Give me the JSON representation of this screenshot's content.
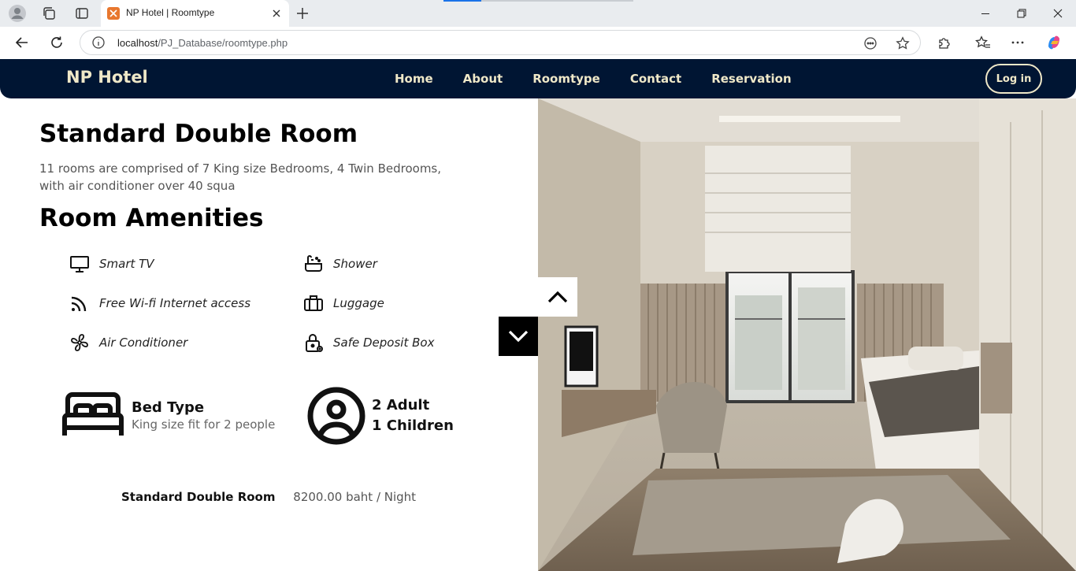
{
  "browser": {
    "tab_title": "NP Hotel | Roomtype",
    "url_host": "localhost",
    "url_path": "/PJ_Database/roomtype.php"
  },
  "site": {
    "brand": "NP Hotel",
    "nav": [
      "Home",
      "About",
      "Roomtype",
      "Contact",
      "Reservation"
    ],
    "login_label": "Log in"
  },
  "room": {
    "title": "Standard Double Room",
    "description": "11 rooms are comprised of 7 King size Bedrooms, 4 Twin Bedrooms, with air conditioner over 40 squa",
    "amenities_title": "Room Amenities",
    "amenities": [
      {
        "label": "Smart TV",
        "icon": "tv-icon"
      },
      {
        "label": "Shower",
        "icon": "bathtub-icon"
      },
      {
        "label": "Free Wi-fi Internet access",
        "icon": "wifi-icon"
      },
      {
        "label": "Luggage",
        "icon": "luggage-icon"
      },
      {
        "label": "Air Conditioner",
        "icon": "fan-icon"
      },
      {
        "label": "Safe Deposit Box",
        "icon": "lock-icon"
      }
    ],
    "bed": {
      "title": "Bed Type",
      "subtitle": "King size fit for 2 people"
    },
    "occupancy": {
      "adults": "2 Adult",
      "children": "1 Children"
    },
    "price": {
      "name": "Standard Double Room",
      "value": "8200.00 baht / Night"
    }
  },
  "colors": {
    "nav_bg": "#001533",
    "nav_text": "#efe8c8",
    "heading": "#000000",
    "body_text": "#555555"
  }
}
